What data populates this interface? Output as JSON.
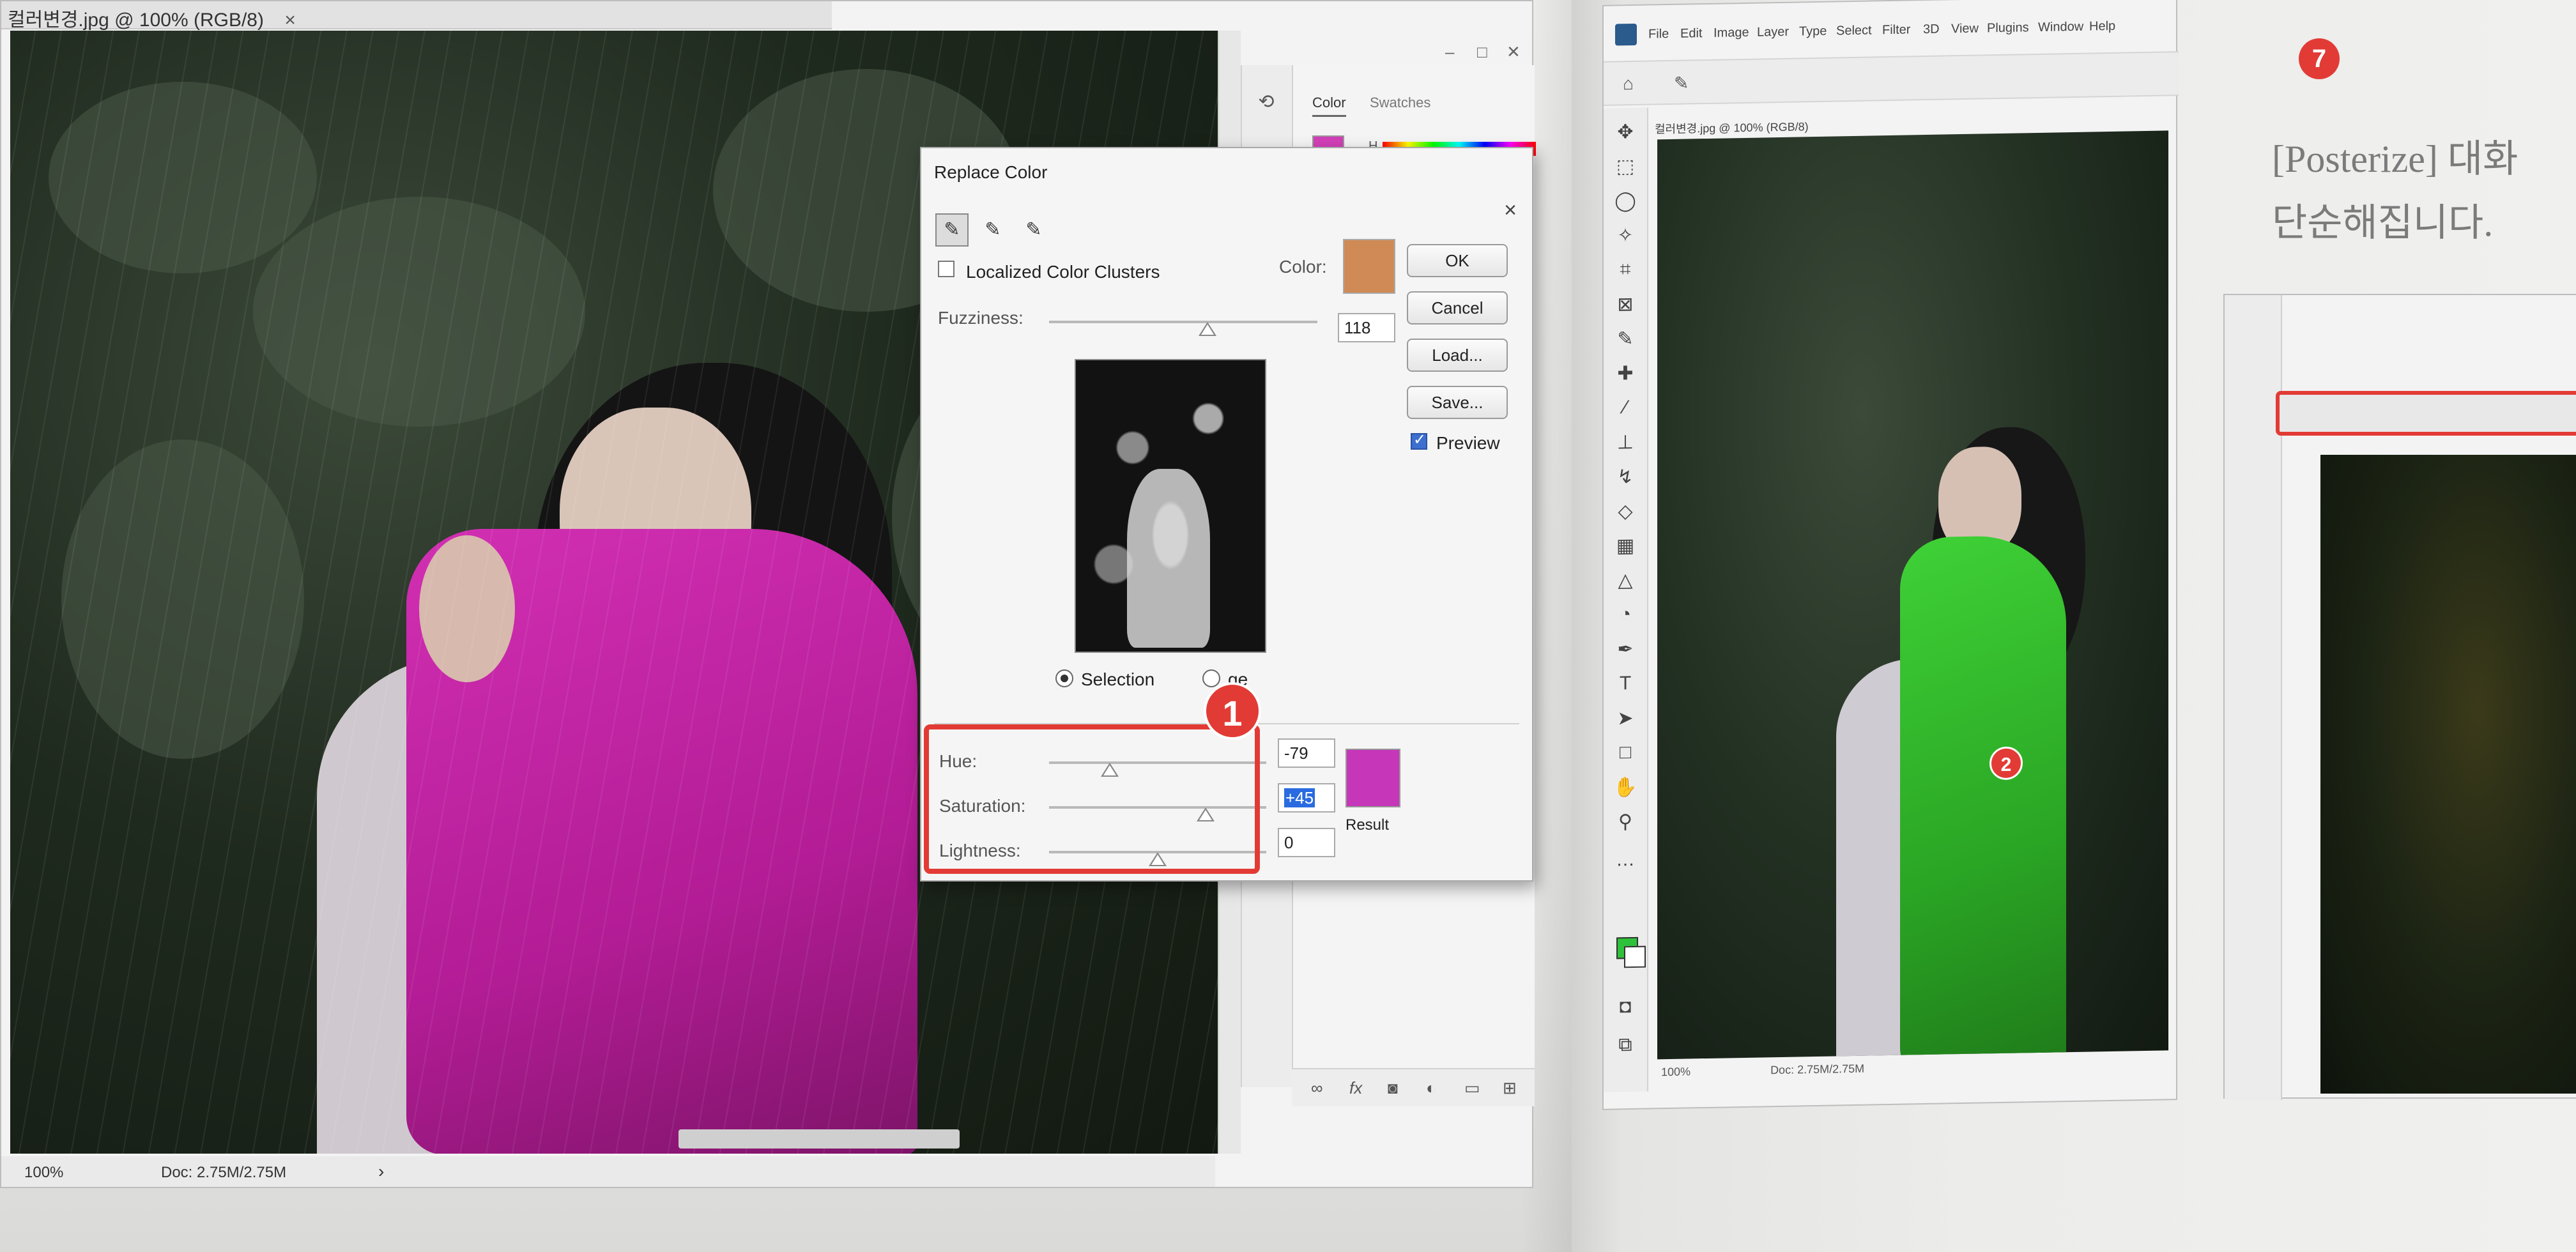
{
  "left_window": {
    "tab_title": "컬러변경.jpg @ 100% (RGB/8)",
    "tab_close": "×",
    "status_zoom": "100%",
    "status_doc": "Doc: 2.75M/2.75M",
    "status_arrow": "›",
    "color_panel": {
      "tab_color": "Color",
      "tab_swatches": "Swatches",
      "h_label": "H"
    },
    "footer_icons": [
      "link-icon",
      "fx-icon",
      "mask-icon",
      "adjustment-icon",
      "folder-icon",
      "new-layer-icon"
    ]
  },
  "replace_color": {
    "title": "Replace Color",
    "close": "×",
    "localized_label": "Localized Color Clusters",
    "localized_checked": false,
    "color_label": "Color:",
    "sample_color": "#cf8a55",
    "fuzziness_label": "Fuzziness:",
    "fuzziness_value": "118",
    "fuzziness_fraction": 0.59,
    "buttons": {
      "ok": "OK",
      "cancel": "Cancel",
      "load": "Load...",
      "save": "Save..."
    },
    "preview_label": "Preview",
    "preview_checked": true,
    "selection_label": "Selection",
    "image_label": "ge",
    "selection_mode": "selection",
    "hue_label": "Hue:",
    "hue_value": "-79",
    "hue_fraction": 0.28,
    "saturation_label": "Saturation:",
    "saturation_value": "+45",
    "saturation_fraction": 0.72,
    "lightness_label": "Lightness:",
    "lightness_value": "0",
    "lightness_fraction": 0.5,
    "result_label": "Result",
    "result_color": "#c536b8",
    "annotation_number": "1"
  },
  "right_window": {
    "menu": [
      "File",
      "Edit",
      "Image",
      "Layer",
      "Type",
      "Select",
      "Filter",
      "3D",
      "View",
      "Plugins",
      "Window",
      "Help"
    ],
    "doc_tab": "컬러변경.jpg @ 100% (RGB/8)",
    "status_zoom": "100%",
    "status_doc": "Doc: 2.75M/2.75M",
    "foreground_color": "#2ec13a",
    "annotation_number": "2"
  },
  "book": {
    "step_number": "7",
    "step_text": "",
    "line1": "[Posterize] 대화",
    "line2": "단순해집니다."
  }
}
